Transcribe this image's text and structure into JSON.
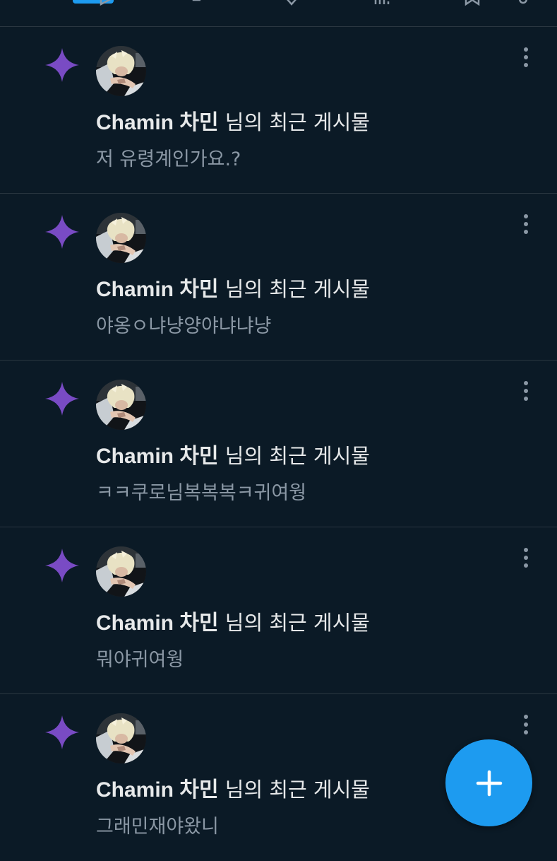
{
  "colors": {
    "background": "#0b1a26",
    "divider": "#2a3640",
    "accent": "#1d9bf0",
    "sparkle": "#794bc4",
    "text_primary": "#e7e9ea",
    "text_secondary": "#8b98a5"
  },
  "top_bar": {
    "icons": [
      "reply-icon",
      "retweet-icon",
      "like-icon",
      "views-icon",
      "bookmark-icon",
      "share-icon"
    ]
  },
  "notifications": [
    {
      "icon": "sparkle-icon",
      "author": "Chamin 차민",
      "suffix": " 님의 최근 게시물",
      "snippet": "저 유령계인가요.?"
    },
    {
      "icon": "sparkle-icon",
      "author": "Chamin 차민",
      "suffix": " 님의 최근 게시물",
      "snippet": "야옹ㅇ냐냥양야냐냐냥"
    },
    {
      "icon": "sparkle-icon",
      "author": "Chamin 차민",
      "suffix": " 님의 최근 게시물",
      "snippet": "ㅋㅋ쿠로님복복복ㅋ귀여웡"
    },
    {
      "icon": "sparkle-icon",
      "author": "Chamin 차민",
      "suffix": " 님의 최근 게시물",
      "snippet": "뭐야귀여웡"
    },
    {
      "icon": "sparkle-icon",
      "author": "Chamin 차민",
      "suffix": " 님의 최근 게시물",
      "snippet": "그래민재야왔니"
    }
  ],
  "fab": {
    "icon": "plus-icon"
  }
}
